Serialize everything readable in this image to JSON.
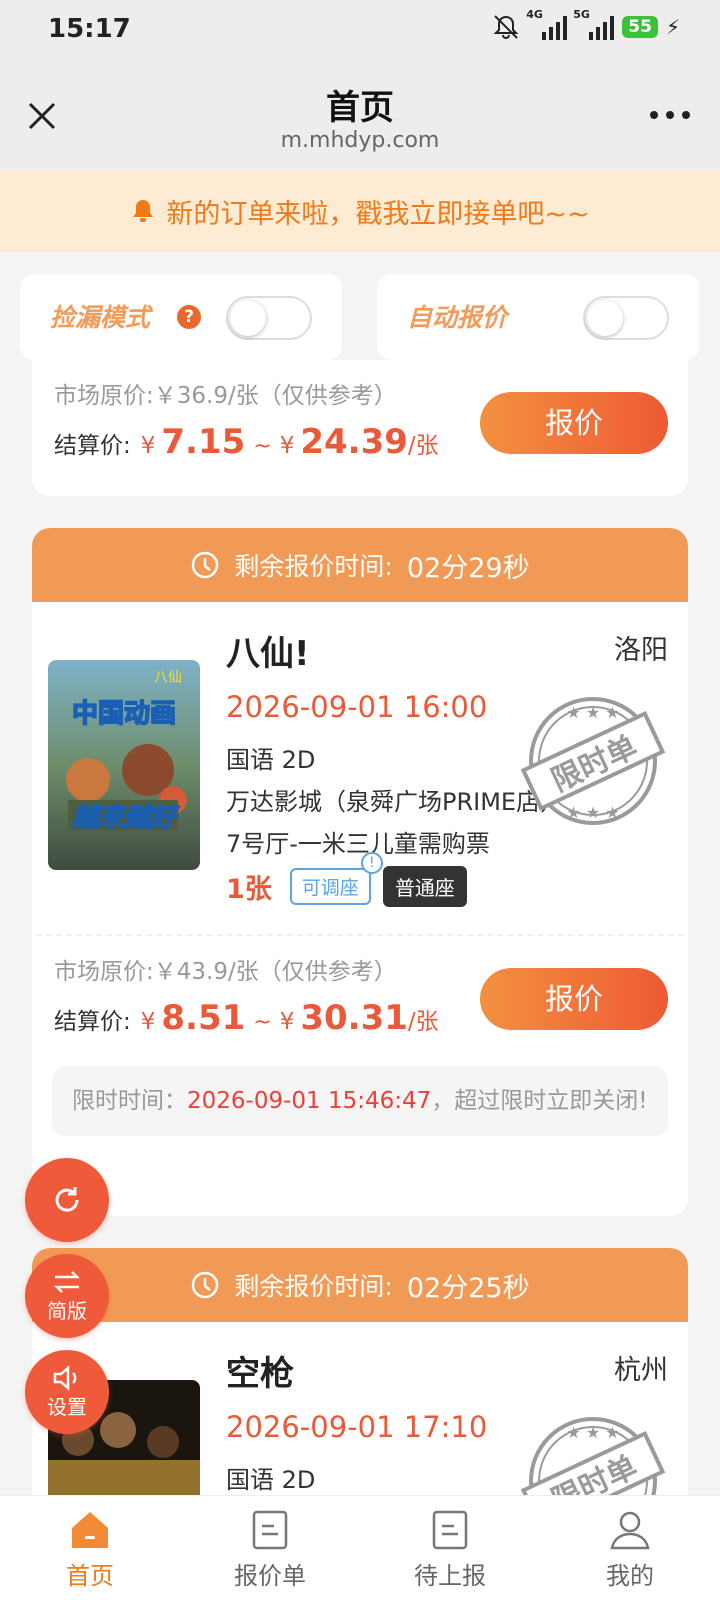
{
  "status_bar": {
    "time": "15:17",
    "battery": "55",
    "net1": "4G",
    "net2": "5G"
  },
  "header": {
    "title": "首页",
    "url": "m.mhdyp.com"
  },
  "notice": {
    "text": "新的订单来啦，戳我立即接单吧~~"
  },
  "toggles": {
    "pickup_mode": "捡漏模式",
    "auto_quote": "自动报价"
  },
  "labels": {
    "settle": "结算价:",
    "yuan": "¥",
    "tilde": "~",
    "per_ticket": "/张",
    "quote_button": "报价",
    "countdown_label": "剩余报价时间:",
    "adjustable": "可调座",
    "stamp_text": "限时单"
  },
  "orders": [
    {
      "market_price": "市场原价:￥36.9/张（仅供参考）",
      "price_min": "7.15",
      "price_max": "24.39"
    },
    {
      "countdown": "02分29秒",
      "title": "八仙!",
      "city": "洛阳",
      "datetime": "2026-09-01 16:00",
      "language": "国语 2D",
      "cinema": "万达影城（泉舜广场PRIME店）",
      "hall": "7号厅-一米三儿童需购票",
      "quantity": "1张",
      "seat_type": "普通座",
      "poster_text_1": "中国动画",
      "poster_text_2": "越来越好",
      "poster_logo": "八仙",
      "market_price": "市场原价:￥43.9/张（仅供参考）",
      "price_min": "8.51",
      "price_max": "30.31",
      "limit_label": "限时时间：",
      "limit_time": "2026-09-01 15:46:47",
      "limit_suffix": "，超过限时立即关闭!"
    },
    {
      "countdown": "02分25秒",
      "title": "空枪",
      "city": "杭州",
      "datetime": "2026-09-01 17:10",
      "language": "国语 2D"
    }
  ],
  "fabs": {
    "simple": "简版",
    "settings": "设置"
  },
  "nav": [
    {
      "label": "首页"
    },
    {
      "label": "报价单"
    },
    {
      "label": "待上报"
    },
    {
      "label": "我的"
    }
  ],
  "colors": {
    "accent": "#ee5a3a",
    "header_orange": "#f09a55",
    "price_red": "#e85a3a",
    "notice_bg": "#fdebd4"
  }
}
